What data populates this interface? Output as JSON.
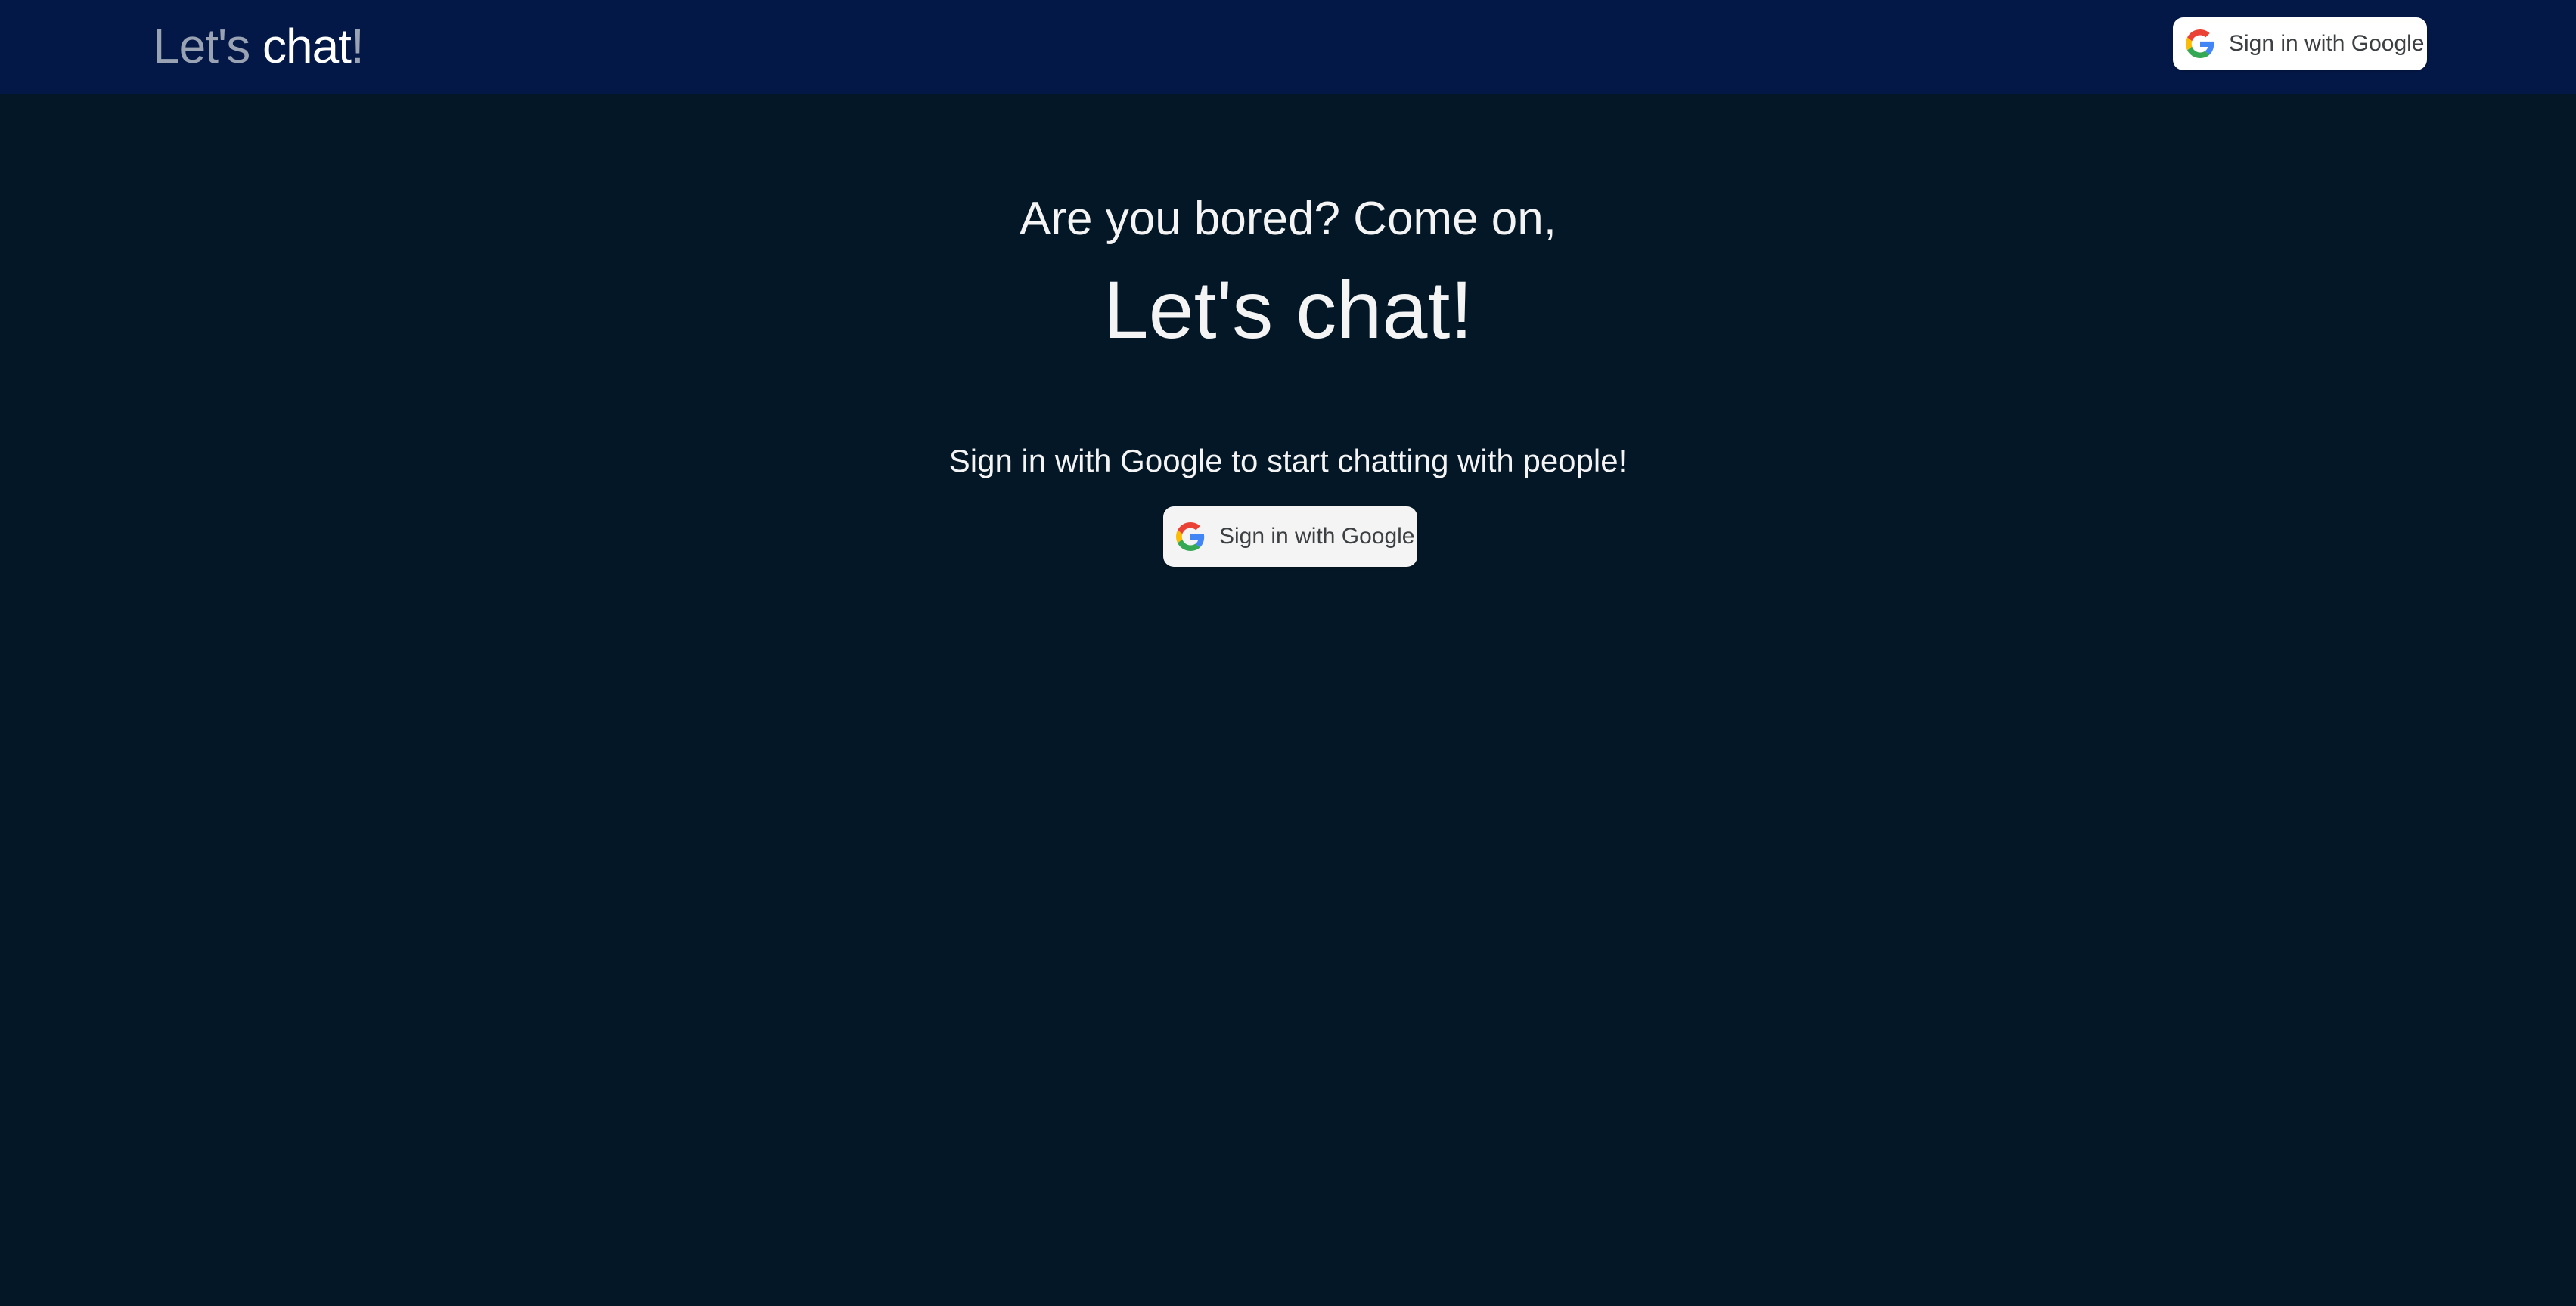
{
  "header": {
    "logo_part1": "Let's",
    "logo_part2": "chat",
    "logo_part3": "!",
    "signin_label": "Sign in with Google",
    "signin_icon": "google-g-icon"
  },
  "hero": {
    "subhead": "Are you bored? Come on,",
    "headline": "Let's chat!",
    "tagline": "Sign in with Google to start chatting with people!",
    "signin_label": "Sign in with Google",
    "signin_icon": "google-g-icon"
  },
  "colors": {
    "header_bg": "#041847",
    "page_bg": "#031726",
    "button_bg": "#ffffff",
    "button_text": "#3c4043"
  }
}
